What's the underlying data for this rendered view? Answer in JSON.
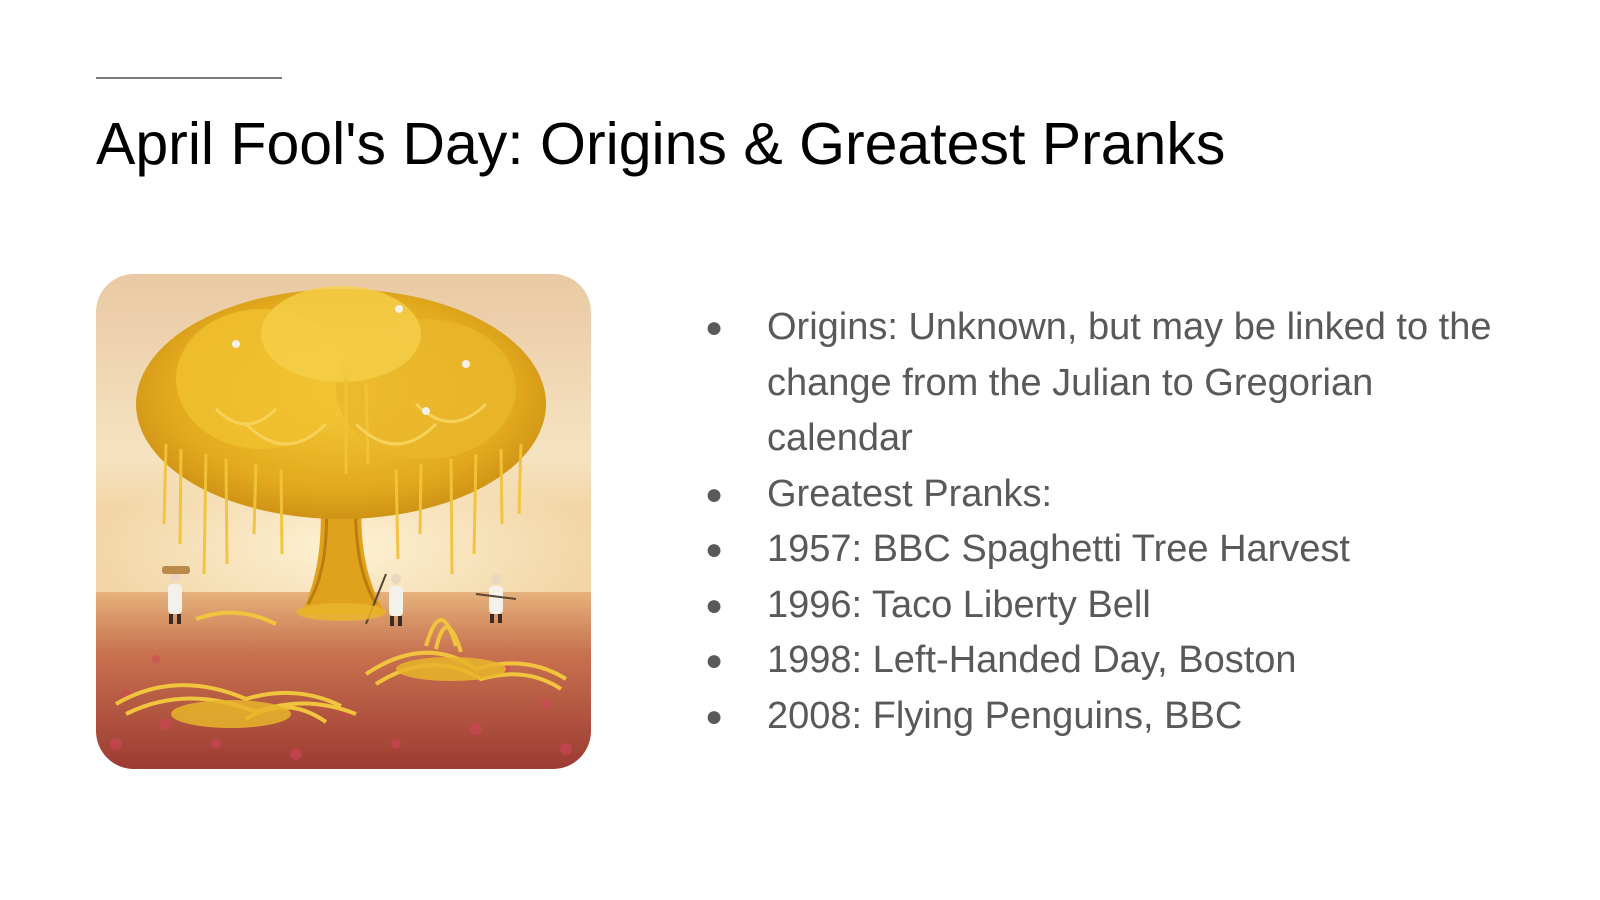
{
  "slide": {
    "title": "April Fool's Day: Origins & Greatest Pranks",
    "illustration_icon": "spaghetti-tree-illustration",
    "bullet_glyph": "●",
    "bullets": [
      "Origins: Unknown, but may be linked to the change from the Julian to Gregorian calendar",
      "Greatest Pranks:",
      "1957: BBC Spaghetti Tree Harvest",
      "1996: Taco Liberty Bell",
      "1998: Left-Handed Day, Boston",
      "2008: Flying Penguins, BBC"
    ]
  },
  "colors": {
    "title": "#000000",
    "body_text": "#595959",
    "rule": "#7a7a7a",
    "sky": "#f3dcb8",
    "foliage": "#e8b521",
    "field": "#b9543f"
  }
}
